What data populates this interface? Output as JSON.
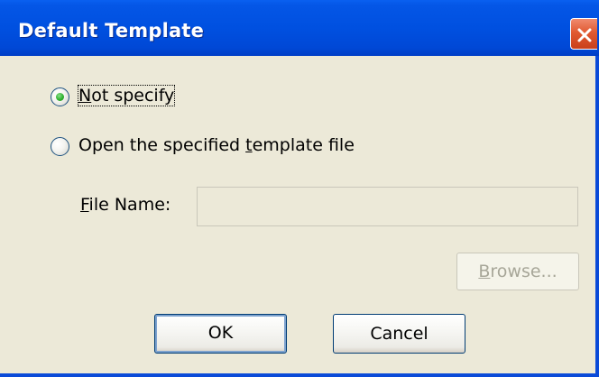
{
  "dialog": {
    "title": "Default Template"
  },
  "options": [
    {
      "label_first": "N",
      "label_rest": "ot specify",
      "selected": true
    },
    {
      "label_before": "Open the specified ",
      "label_underlined": "t",
      "label_after": "emplate file",
      "selected": false
    }
  ],
  "file_name": {
    "label_underlined": "F",
    "label_rest": "ile Name:",
    "value": ""
  },
  "buttons": {
    "browse_underlined": "B",
    "browse_rest": "rowse...",
    "ok": "OK",
    "cancel": "Cancel"
  },
  "colors": {
    "titlebar": "#0050e0",
    "client": "#ece9d8",
    "close_button": "#e15a32",
    "radio_selected": "#2fb12f"
  },
  "icons": {
    "close": "close-icon"
  }
}
